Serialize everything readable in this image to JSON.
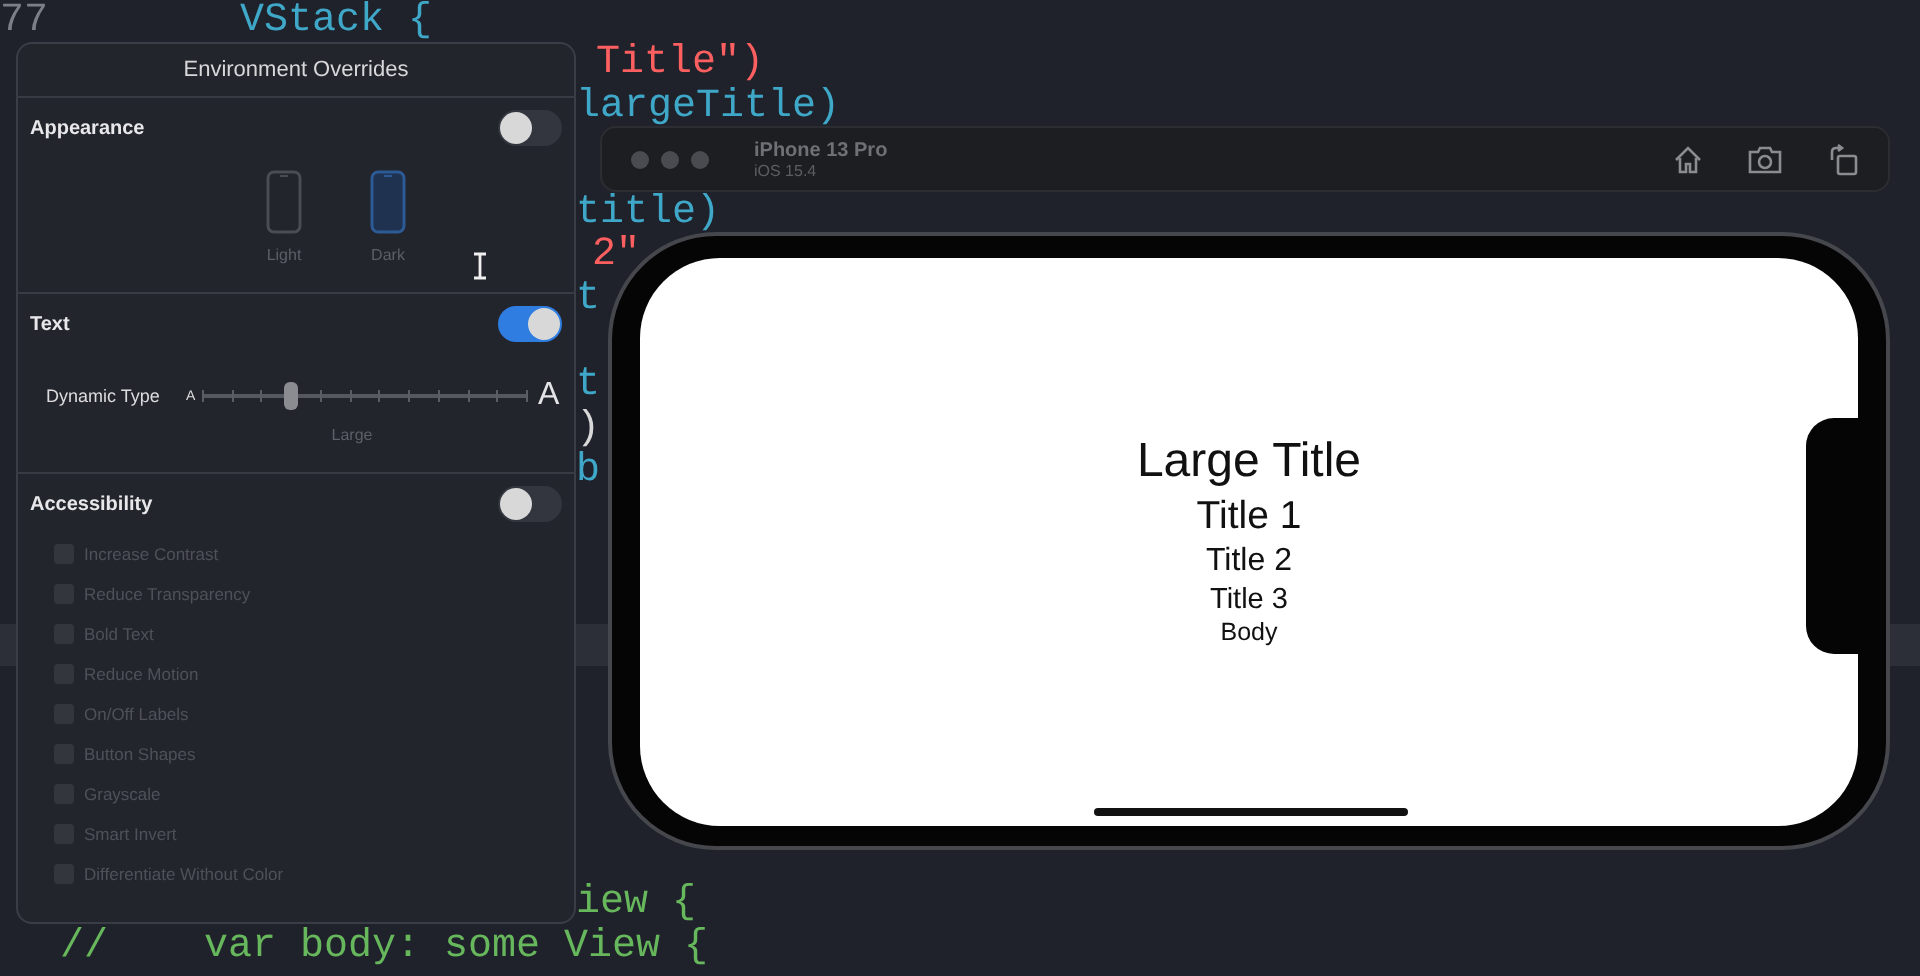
{
  "editor": {
    "lines": [
      {
        "number": "77",
        "code": "VStack {",
        "color": "#3fa8c8",
        "selected": false
      },
      {
        "code": "Title\")",
        "color": "#fc5f60",
        "selected": false
      },
      {
        "code": "largeTitle)",
        "color": "#3fa8c8",
        "selected": false
      },
      {
        "selected": false
      },
      {
        "code": "title)",
        "color": "#3fa8c8",
        "selected": false
      },
      {
        "code": "2\"",
        "color": "#fc5f60",
        "selected": false
      },
      {
        "code": "t",
        "color": "#3fa8c8",
        "selected": false
      },
      {
        "selected": false
      },
      {
        "code": "t",
        "color": "#3fa8c8",
        "selected": false
      },
      {
        "code": ")",
        "color": "#d8d8d8",
        "selected": false
      },
      {
        "code": "b",
        "color": "#3fa8c8",
        "selected": false
      },
      {
        "selected": false
      },
      {
        "selected": false
      },
      {
        "selected": false
      },
      {
        "selected": true
      },
      {
        "selected": false
      },
      {
        "selected": false
      },
      {
        "selected": false
      },
      {
        "selected": false
      },
      {
        "selected": false
      },
      {
        "code": "iew {",
        "color": "#67b75c",
        "selected": false
      },
      {
        "code": "//    var body: some View {",
        "color": "#67b75c",
        "selected": false
      }
    ]
  },
  "overrides": {
    "title": "Environment Overrides",
    "appearance": {
      "label": "Appearance",
      "on": false,
      "options": [
        {
          "label": "Light",
          "selected": false
        },
        {
          "label": "Dark",
          "selected": true
        }
      ]
    },
    "text": {
      "label": "Text",
      "on": true,
      "dynamic_type": {
        "label": "Dynamic Type",
        "small_glyph": "A",
        "large_glyph": "A",
        "level": 0.27,
        "value": "Large"
      }
    },
    "accessibility": {
      "label": "Accessibility",
      "on": false,
      "options": [
        {
          "label": "Increase Contrast",
          "checked": false,
          "disabled": true
        },
        {
          "label": "Reduce Transparency",
          "checked": false,
          "disabled": true
        },
        {
          "label": "Bold Text",
          "checked": false,
          "disabled": true
        },
        {
          "label": "Reduce Motion",
          "checked": false,
          "disabled": true
        },
        {
          "label": "On/Off Labels",
          "checked": false,
          "disabled": true
        },
        {
          "label": "Button Shapes",
          "checked": false,
          "disabled": true
        },
        {
          "label": "Grayscale",
          "checked": false,
          "disabled": true
        },
        {
          "label": "Smart Invert",
          "checked": false,
          "disabled": true
        },
        {
          "label": "Differentiate Without Color",
          "checked": false,
          "disabled": true
        }
      ]
    }
  },
  "simulator": {
    "device": "iPhone 13 Pro",
    "os": "iOS 15.4",
    "screen": [
      {
        "kind": "large-title",
        "text": "Large Title"
      },
      {
        "kind": "title1",
        "text": "Title 1"
      },
      {
        "kind": "title2",
        "text": "Title 2"
      },
      {
        "kind": "title3",
        "text": "Title 3"
      },
      {
        "kind": "body",
        "text": "Body"
      }
    ]
  }
}
